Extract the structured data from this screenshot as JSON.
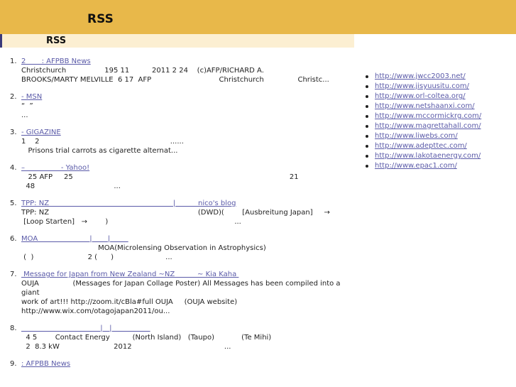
{
  "header": {
    "title": "RSS"
  },
  "section": {
    "title": "RSS"
  },
  "feed": [
    {
      "num": "1.",
      "link": "2       : AFPBB News",
      "lines": [
        "Christchurch                 195 11          2011 2 24    (c)AFP/RICHARD A.",
        "BROOKS/MARTY MELVILLE  6 17  AFP                              Christchurch               Christc..."
      ]
    },
    {
      "num": "2.",
      "link": "- MSN",
      "lines": [
        "“  ”",
        "..."
      ]
    },
    {
      "num": "3.",
      "link": "- GIGAZINE",
      "lines": [
        "1    2                                                          ......",
        "   Prisons trial carrots as cigarette alternat..."
      ]
    },
    {
      "num": "4.",
      "link": "–                - Yahoo!",
      "lines": [
        "   25 AFP     25                                                                                                21",
        "  48                                   ..."
      ]
    },
    {
      "num": "5.",
      "link": "TPP: NZ                                                       |          nico's blog",
      "lines": [
        "TPP: NZ                                                                  (DWD)(        [Ausbreitung Japan]     →",
        " [Loop Starten]   →        )                                                        ..."
      ]
    },
    {
      "num": "6.",
      "link": "MOA                       |       |        ",
      "lines": [
        "                                  MOA(Microlensing Observation in Astrophysics)",
        " (  )                        2 (      )                       ..."
      ]
    },
    {
      "num": "7.",
      "link": " Message for Japan from New Zealand ~NZ          ~ Kia Kaha ",
      "lines": [
        "OUJA               (Messages for Japan Collage Poster) All Messages has been compiled into a giant",
        "work of art!!! http://zoom.it/cBla#full OUJA     (OUJA website)",
        "http://www.wix.com/otagojapan2011/ou..."
      ]
    },
    {
      "num": "8.",
      "link": "                                   |   |                 ",
      "lines": [
        "  4 5        Contact Energy          (North Island)   (Taupo)            (Te Mihi)",
        "  2  8.3 kW                        2012                                         ..."
      ]
    },
    {
      "num": "9.",
      "link": ": AFPBB News",
      "lines": []
    }
  ],
  "sidebar": {
    "links": [
      "http://www.jwcc2003.net/",
      "http://www.jisyuusitu.com/",
      "http://www.orl-coltea.org/",
      "http://www.netshaanxi.com/",
      "http://www.mccormickrg.com/",
      "http://www.magrettahall.com/",
      "http://www.liwebs.com/",
      "http://www.adepttec.com/",
      "http://www.lakotaenergy.com/",
      "http://www.epac1.com/"
    ]
  },
  "colors": {
    "header_bg": "#e8b84a",
    "subheader_bg": "#fcefd2",
    "link": "#5a5aa8"
  }
}
